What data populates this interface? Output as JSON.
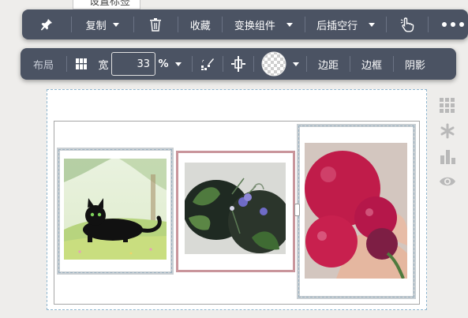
{
  "top_tab": {
    "label": "设置标签"
  },
  "toolbar_main": {
    "pin_icon": "pin-icon",
    "copy_label": "复制",
    "delete_icon": "trash-icon",
    "favorite_label": "收藏",
    "switch_component_label": "变换组件",
    "insert_row_after_label": "后插空行",
    "select_hand_icon": "hand-pointer-icon",
    "more_icon": "more-icon"
  },
  "toolbar_layout": {
    "layout_label": "布局",
    "grid_icon": "grid-icon",
    "width_label": "宽",
    "width_value": "33",
    "unit_label": "%",
    "style_brush_icon": "style-brush-icon",
    "align_icon": "vertical-align-icon",
    "background_swatch_icon": "transparent-swatch-icon",
    "margin_label": "边距",
    "border_label": "边框",
    "shadow_label": "阴影"
  },
  "side_panel": {
    "icons": [
      "apps-grid-icon",
      "asterisk-icon",
      "bar-chart-icon",
      "eye-icon"
    ]
  },
  "colors": {
    "toolbar_bg": "#4b5363",
    "selected_border": "#c9959b",
    "column_border": "#c9cfd3",
    "canvas_dashed": "#8fb6cf"
  },
  "images": [
    {
      "name": "black-cat-image",
      "subject": "cat"
    },
    {
      "name": "flowers-image",
      "subject": "flowers"
    },
    {
      "name": "plums-image",
      "subject": "plums"
    }
  ]
}
